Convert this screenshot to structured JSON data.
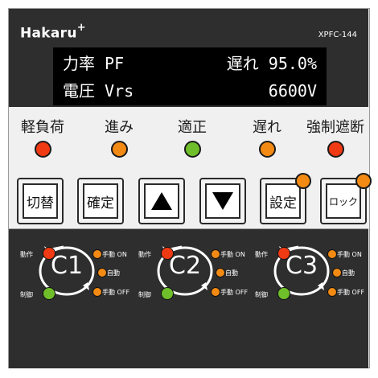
{
  "brand": {
    "name": "Hakaru",
    "plus": "+"
  },
  "model": "XPFC-144",
  "lcd": {
    "row1_label": "力率 PF",
    "row1_value": "遅れ 95.0%",
    "row2_label": "電圧 Vrs",
    "row2_value": "6600V"
  },
  "indicators": [
    {
      "label": "軽負荷",
      "color": "#f03a14"
    },
    {
      "label": "進み",
      "color": "#f28a13"
    },
    {
      "label": "適正",
      "color": "#6fbf2a"
    },
    {
      "label": "遅れ",
      "color": "#f28a13"
    },
    {
      "label": "強制遮断",
      "color": "#f03a14"
    }
  ],
  "buttons": {
    "switch": "切替",
    "confirm": "確定",
    "up": "▲",
    "down": "▼",
    "settings": "設定",
    "lock": "ロック"
  },
  "channels": [
    {
      "label": "C1",
      "operate": "動作",
      "control": "制御",
      "manual_on": "手動 ON",
      "auto": "自動",
      "manual_off": "手動 OFF"
    },
    {
      "label": "C2",
      "operate": "動作",
      "control": "制御",
      "manual_on": "手動 ON",
      "auto": "自動",
      "manual_off": "手動 OFF"
    },
    {
      "label": "C3",
      "operate": "動作",
      "control": "制御",
      "manual_on": "手動 ON",
      "auto": "自動",
      "manual_off": "手動 OFF"
    }
  ],
  "colors": {
    "panel_dark": "#2e2e2e",
    "led_orange": "#f28a13",
    "led_red": "#f03a14",
    "led_green": "#6fbf2a"
  }
}
